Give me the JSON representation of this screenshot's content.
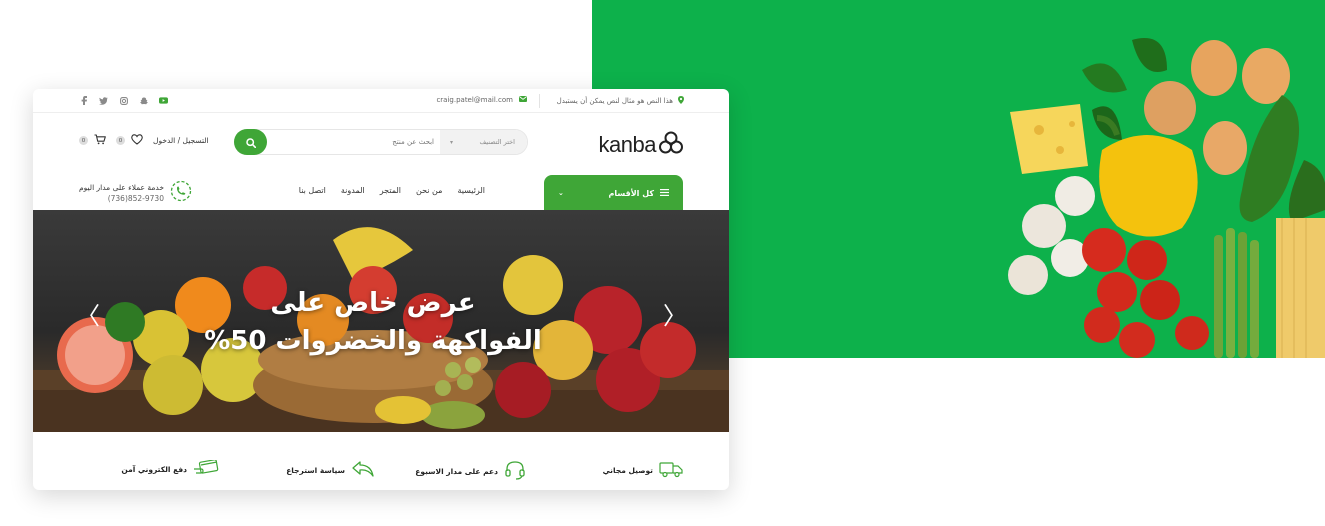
{
  "topbar": {
    "promo_text": "هذا النص هو مثال لنص يمكن أن يستبدل",
    "email": "craig.patel@mail.com",
    "social_icons": [
      "facebook-icon",
      "twitter-icon",
      "instagram-icon",
      "snapchat-icon",
      "youtube-icon"
    ]
  },
  "header": {
    "logo_text": "kanba",
    "search_placeholder": "ابحث عن منتج",
    "search_category": "اختر التصنيف",
    "account_label": "التسجيل / الدخول",
    "wishlist_count": "0",
    "cart_count": "0"
  },
  "nav": {
    "categories_label": "كل الأقسام",
    "items": [
      "الرئيسية",
      "من نحن",
      "المتجر",
      "المدونة",
      "اتصل بنا"
    ],
    "support_title": "خدمة عملاء على مدار اليوم",
    "support_phone": "(736)852-9730"
  },
  "hero": {
    "title_line1": "عرض خاص على",
    "title_line2": "الفواكهة والخضروات 50%"
  },
  "features": [
    {
      "label": "توصيل مجاني",
      "icon": "truck-icon"
    },
    {
      "label": "دعم على مدار الاسبوع",
      "icon": "headset-icon"
    },
    {
      "label": "سياسة استرجاع",
      "icon": "return-arrow-icon"
    },
    {
      "label": "دفع الكتروني آمن",
      "icon": "card-payment-icon"
    }
  ],
  "colors": {
    "brand_green": "#3fa637",
    "promo_green": "#0db14b"
  }
}
